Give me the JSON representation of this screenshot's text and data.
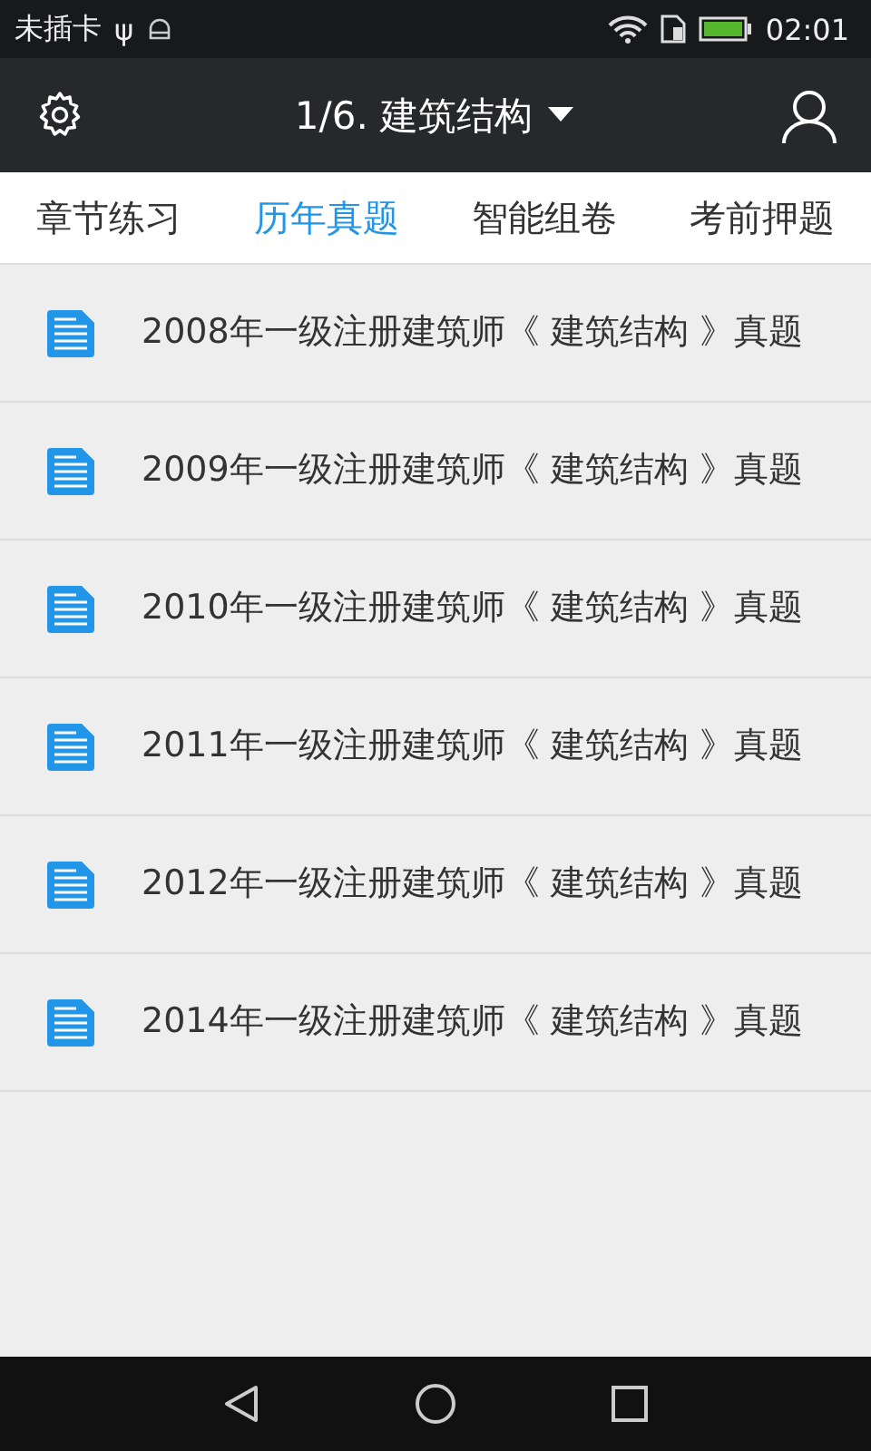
{
  "status_bar": {
    "carrier": "未插卡",
    "usb": "ψ",
    "time": "02:01"
  },
  "header": {
    "title": "1/6. 建筑结构"
  },
  "tabs": [
    {
      "label": "章节练习",
      "selected": false
    },
    {
      "label": "历年真题",
      "selected": true
    },
    {
      "label": "智能组卷",
      "selected": false
    },
    {
      "label": "考前押题",
      "selected": false
    }
  ],
  "items": [
    {
      "title": "2008年一级注册建筑师《 建筑结构 》真题"
    },
    {
      "title": "2009年一级注册建筑师《 建筑结构 》真题"
    },
    {
      "title": "2010年一级注册建筑师《 建筑结构 》真题"
    },
    {
      "title": "2011年一级注册建筑师《 建筑结构 》真题"
    },
    {
      "title": "2012年一级注册建筑师《 建筑结构 》真题"
    },
    {
      "title": "2014年一级注册建筑师《 建筑结构 》真题"
    }
  ]
}
